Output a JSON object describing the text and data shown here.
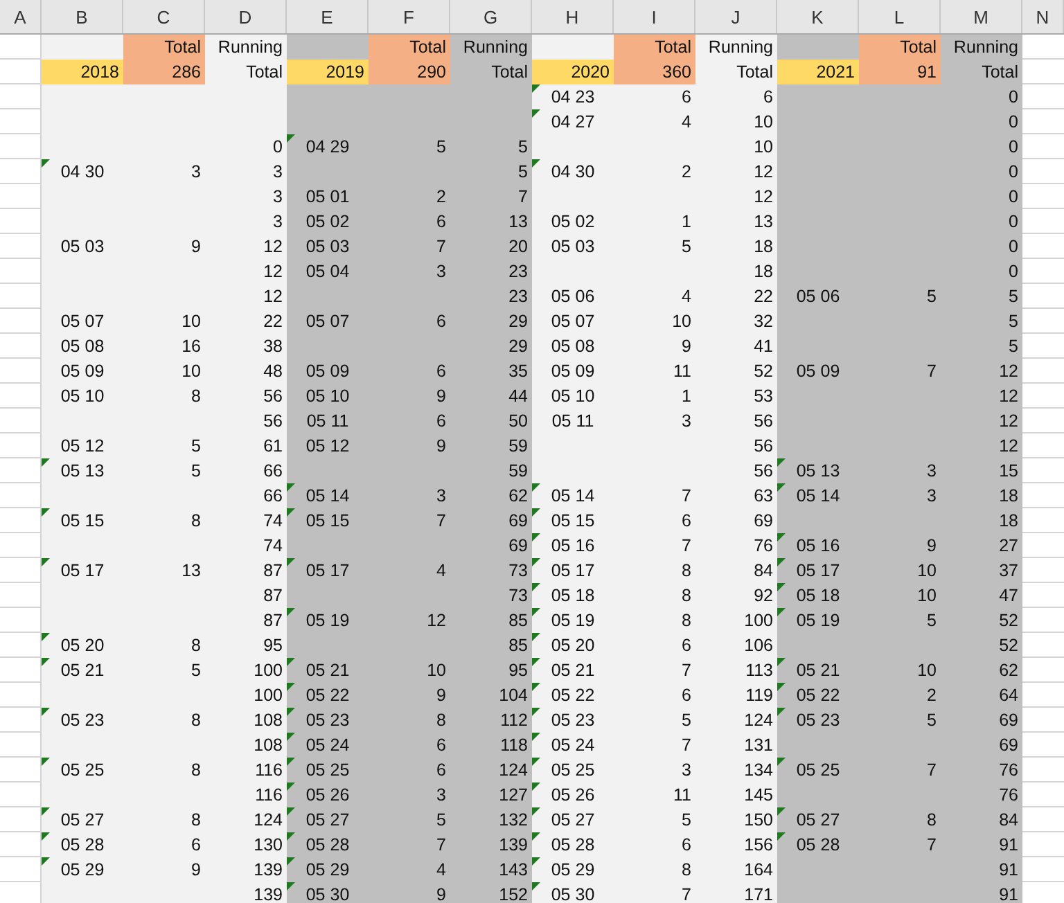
{
  "columns": [
    "A",
    "B",
    "C",
    "D",
    "E",
    "F",
    "G",
    "H",
    "I",
    "J",
    "K",
    "L",
    "M",
    "N"
  ],
  "groups": [
    {
      "year": "2018",
      "total_label": "Total",
      "total": "286",
      "running_label": "Running",
      "running_label_2": "Total",
      "color": "#f2f2f2"
    },
    {
      "year": "2019",
      "total_label": "Total",
      "total": "290",
      "running_label": "Running",
      "running_label_2": "Total",
      "color": "#bfbfbf"
    },
    {
      "year": "2020",
      "total_label": "Total",
      "total": "360",
      "running_label": "Running",
      "running_label_2": "Total",
      "color": "#f2f2f2"
    },
    {
      "year": "2021",
      "total_label": "Total",
      "total": "91",
      "running_label": "Running",
      "running_label_2": "Total",
      "color": "#bfbfbf"
    }
  ],
  "rows": [
    [
      {},
      {},
      {
        "date": "04 23",
        "count": "6",
        "running": "6",
        "flagged": true
      },
      {
        "running": "0"
      }
    ],
    [
      {},
      {},
      {
        "date": "04 27",
        "count": "4",
        "running": "10",
        "flagged": true
      },
      {
        "running": "0"
      }
    ],
    [
      {
        "running": "0"
      },
      {
        "date": "04 29",
        "count": "5",
        "running": "5",
        "flagged": true
      },
      {
        "running": "10"
      },
      {
        "running": "0"
      }
    ],
    [
      {
        "date": "04 30",
        "count": "3",
        "running": "3",
        "flagged": true
      },
      {
        "running": "5"
      },
      {
        "date": "04 30",
        "count": "2",
        "running": "12",
        "flagged": true
      },
      {
        "running": "0"
      }
    ],
    [
      {
        "running": "3"
      },
      {
        "date": "05 01",
        "count": "2",
        "running": "7",
        "flagged": false
      },
      {
        "running": "12"
      },
      {
        "running": "0"
      }
    ],
    [
      {
        "running": "3"
      },
      {
        "date": "05 02",
        "count": "6",
        "running": "13",
        "flagged": false
      },
      {
        "date": "05 02",
        "count": "1",
        "running": "13",
        "flagged": false
      },
      {
        "running": "0"
      }
    ],
    [
      {
        "date": "05 03",
        "count": "9",
        "running": "12",
        "flagged": false
      },
      {
        "date": "05 03",
        "count": "7",
        "running": "20",
        "flagged": false
      },
      {
        "date": "05 03",
        "count": "5",
        "running": "18",
        "flagged": false
      },
      {
        "running": "0"
      }
    ],
    [
      {
        "running": "12"
      },
      {
        "date": "05 04",
        "count": "3",
        "running": "23",
        "flagged": false
      },
      {
        "running": "18"
      },
      {
        "running": "0"
      }
    ],
    [
      {
        "running": "12"
      },
      {
        "running": "23"
      },
      {
        "date": "05 06",
        "count": "4",
        "running": "22",
        "flagged": false
      },
      {
        "date": "05 06",
        "count": "5",
        "running": "5",
        "flagged": false
      }
    ],
    [
      {
        "date": "05 07",
        "count": "10",
        "running": "22",
        "flagged": false
      },
      {
        "date": "05 07",
        "count": "6",
        "running": "29",
        "flagged": false
      },
      {
        "date": "05 07",
        "count": "10",
        "running": "32",
        "flagged": false
      },
      {
        "running": "5"
      }
    ],
    [
      {
        "date": "05 08",
        "count": "16",
        "running": "38",
        "flagged": false
      },
      {
        "running": "29"
      },
      {
        "date": "05 08",
        "count": "9",
        "running": "41",
        "flagged": false
      },
      {
        "running": "5"
      }
    ],
    [
      {
        "date": "05 09",
        "count": "10",
        "running": "48",
        "flagged": false
      },
      {
        "date": "05 09",
        "count": "6",
        "running": "35",
        "flagged": false
      },
      {
        "date": "05 09",
        "count": "11",
        "running": "52",
        "flagged": false
      },
      {
        "date": "05 09",
        "count": "7",
        "running": "12",
        "flagged": false
      }
    ],
    [
      {
        "date": "05 10",
        "count": "8",
        "running": "56",
        "flagged": false
      },
      {
        "date": "05 10",
        "count": "9",
        "running": "44",
        "flagged": false
      },
      {
        "date": "05 10",
        "count": "1",
        "running": "53",
        "flagged": false
      },
      {
        "running": "12"
      }
    ],
    [
      {
        "running": "56"
      },
      {
        "date": "05 11",
        "count": "6",
        "running": "50",
        "flagged": false
      },
      {
        "date": "05 11",
        "count": "3",
        "running": "56",
        "flagged": false
      },
      {
        "running": "12"
      }
    ],
    [
      {
        "date": "05 12",
        "count": "5",
        "running": "61",
        "flagged": false
      },
      {
        "date": "05 12",
        "count": "9",
        "running": "59",
        "flagged": false
      },
      {
        "running": "56"
      },
      {
        "running": "12"
      }
    ],
    [
      {
        "date": "05 13",
        "count": "5",
        "running": "66",
        "flagged": true
      },
      {
        "running": "59"
      },
      {
        "running": "56"
      },
      {
        "date": "05 13",
        "count": "3",
        "running": "15",
        "flagged": true
      }
    ],
    [
      {
        "running": "66"
      },
      {
        "date": "05 14",
        "count": "3",
        "running": "62",
        "flagged": true
      },
      {
        "date": "05 14",
        "count": "7",
        "running": "63",
        "flagged": true
      },
      {
        "date": "05 14",
        "count": "3",
        "running": "18",
        "flagged": true
      }
    ],
    [
      {
        "date": "05 15",
        "count": "8",
        "running": "74",
        "flagged": true
      },
      {
        "date": "05 15",
        "count": "7",
        "running": "69",
        "flagged": true
      },
      {
        "date": "05 15",
        "count": "6",
        "running": "69",
        "flagged": true
      },
      {
        "running": "18"
      }
    ],
    [
      {
        "running": "74"
      },
      {
        "running": "69"
      },
      {
        "date": "05 16",
        "count": "7",
        "running": "76",
        "flagged": true
      },
      {
        "date": "05 16",
        "count": "9",
        "running": "27",
        "flagged": true
      }
    ],
    [
      {
        "date": "05 17",
        "count": "13",
        "running": "87",
        "flagged": true
      },
      {
        "date": "05 17",
        "count": "4",
        "running": "73",
        "flagged": true
      },
      {
        "date": "05 17",
        "count": "8",
        "running": "84",
        "flagged": true
      },
      {
        "date": "05 17",
        "count": "10",
        "running": "37",
        "flagged": true
      }
    ],
    [
      {
        "running": "87"
      },
      {
        "running": "73"
      },
      {
        "date": "05 18",
        "count": "8",
        "running": "92",
        "flagged": true
      },
      {
        "date": "05 18",
        "count": "10",
        "running": "47",
        "flagged": true
      }
    ],
    [
      {
        "running": "87"
      },
      {
        "date": "05 19",
        "count": "12",
        "running": "85",
        "flagged": true
      },
      {
        "date": "05 19",
        "count": "8",
        "running": "100",
        "flagged": true
      },
      {
        "date": "05 19",
        "count": "5",
        "running": "52",
        "flagged": true
      }
    ],
    [
      {
        "date": "05 20",
        "count": "8",
        "running": "95",
        "flagged": true
      },
      {
        "running": "85"
      },
      {
        "date": "05 20",
        "count": "6",
        "running": "106",
        "flagged": true
      },
      {
        "running": "52"
      }
    ],
    [
      {
        "date": "05 21",
        "count": "5",
        "running": "100",
        "flagged": true
      },
      {
        "date": "05 21",
        "count": "10",
        "running": "95",
        "flagged": true
      },
      {
        "date": "05 21",
        "count": "7",
        "running": "113",
        "flagged": true
      },
      {
        "date": "05 21",
        "count": "10",
        "running": "62",
        "flagged": true
      }
    ],
    [
      {
        "running": "100"
      },
      {
        "date": "05 22",
        "count": "9",
        "running": "104",
        "flagged": true
      },
      {
        "date": "05 22",
        "count": "6",
        "running": "119",
        "flagged": true
      },
      {
        "date": "05 22",
        "count": "2",
        "running": "64",
        "flagged": true
      }
    ],
    [
      {
        "date": "05 23",
        "count": "8",
        "running": "108",
        "flagged": true
      },
      {
        "date": "05 23",
        "count": "8",
        "running": "112",
        "flagged": true
      },
      {
        "date": "05 23",
        "count": "5",
        "running": "124",
        "flagged": true
      },
      {
        "date": "05 23",
        "count": "5",
        "running": "69",
        "flagged": true
      }
    ],
    [
      {
        "running": "108"
      },
      {
        "date": "05 24",
        "count": "6",
        "running": "118",
        "flagged": true
      },
      {
        "date": "05 24",
        "count": "7",
        "running": "131",
        "flagged": true
      },
      {
        "running": "69"
      }
    ],
    [
      {
        "date": "05 25",
        "count": "8",
        "running": "116",
        "flagged": true
      },
      {
        "date": "05 25",
        "count": "6",
        "running": "124",
        "flagged": true
      },
      {
        "date": "05 25",
        "count": "3",
        "running": "134",
        "flagged": true
      },
      {
        "date": "05 25",
        "count": "7",
        "running": "76",
        "flagged": true
      }
    ],
    [
      {
        "running": "116"
      },
      {
        "date": "05 26",
        "count": "3",
        "running": "127",
        "flagged": true
      },
      {
        "date": "05 26",
        "count": "11",
        "running": "145",
        "flagged": true
      },
      {
        "running": "76"
      }
    ],
    [
      {
        "date": "05 27",
        "count": "8",
        "running": "124",
        "flagged": true
      },
      {
        "date": "05 27",
        "count": "5",
        "running": "132",
        "flagged": true
      },
      {
        "date": "05 27",
        "count": "5",
        "running": "150",
        "flagged": true
      },
      {
        "date": "05 27",
        "count": "8",
        "running": "84",
        "flagged": true
      }
    ],
    [
      {
        "date": "05 28",
        "count": "6",
        "running": "130",
        "flagged": true
      },
      {
        "date": "05 28",
        "count": "7",
        "running": "139",
        "flagged": true
      },
      {
        "date": "05 28",
        "count": "6",
        "running": "156",
        "flagged": true
      },
      {
        "date": "05 28",
        "count": "7",
        "running": "91",
        "flagged": true
      }
    ],
    [
      {
        "date": "05 29",
        "count": "9",
        "running": "139",
        "flagged": true
      },
      {
        "date": "05 29",
        "count": "4",
        "running": "143",
        "flagged": true
      },
      {
        "date": "05 29",
        "count": "8",
        "running": "164",
        "flagged": true
      },
      {
        "running": "91"
      }
    ],
    [
      {
        "running": "139"
      },
      {
        "date": "05 30",
        "count": "9",
        "running": "152",
        "flagged": true
      },
      {
        "date": "05 30",
        "count": "7",
        "running": "171",
        "flagged": true
      },
      {
        "running": "91"
      }
    ]
  ]
}
